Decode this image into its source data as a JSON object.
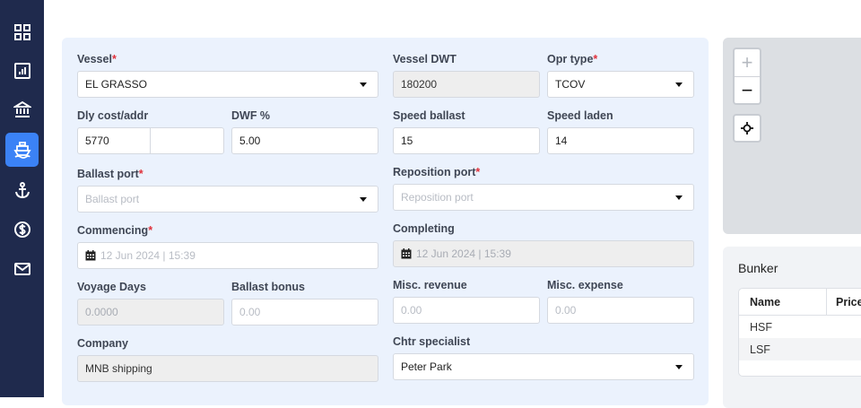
{
  "sidebar": {
    "items": [
      {
        "icon": "dashboard-grid-icon",
        "active": false
      },
      {
        "icon": "report-chart-icon",
        "active": false
      },
      {
        "icon": "bank-icon",
        "active": false
      },
      {
        "icon": "ship-icon",
        "active": true
      },
      {
        "icon": "anchor-icon",
        "active": false
      },
      {
        "icon": "dollar-icon",
        "active": false
      },
      {
        "icon": "mail-icon",
        "active": false
      }
    ],
    "accent": "#3b82f6",
    "background": "#1f2a4d"
  },
  "form": {
    "vessel": {
      "label": "Vessel",
      "required": "*",
      "value": "EL GRASSO"
    },
    "vessel_dwt": {
      "label": "Vessel DWT",
      "value": "180200"
    },
    "opr_type": {
      "label": "Opr type",
      "required": "*",
      "value": "TCOV"
    },
    "dly_cost": {
      "label": "Dly cost/addr",
      "value": "5770",
      "addr_value": ""
    },
    "dwf": {
      "label": "DWF %",
      "value": "5.00"
    },
    "speed_ballast": {
      "label": "Speed ballast",
      "value": "15"
    },
    "speed_laden": {
      "label": "Speed laden",
      "value": "14"
    },
    "ballast_port": {
      "label": "Ballast port",
      "required": "*",
      "placeholder": "Ballast port"
    },
    "reposition_port": {
      "label": "Reposition port",
      "required": "*",
      "placeholder": "Reposition port"
    },
    "commencing": {
      "label": "Commencing",
      "required": "*",
      "placeholder": "12 Jun 2024 | 15:39"
    },
    "completing": {
      "label": "Completing",
      "placeholder": "12 Jun 2024 | 15:39"
    },
    "voyage_days": {
      "label": "Voyage Days",
      "placeholder": "0.0000"
    },
    "ballast_bonus": {
      "label": "Ballast bonus",
      "placeholder": "0.00"
    },
    "misc_revenue": {
      "label": "Misc. revenue",
      "placeholder": "0.00"
    },
    "misc_expense": {
      "label": "Misc. expense",
      "placeholder": "0.00"
    },
    "company": {
      "label": "Company",
      "value": "MNB shipping"
    },
    "chtr_specialist": {
      "label": "Chtr specialist",
      "value": "Peter Park"
    }
  },
  "map": {
    "zoom_in": "+",
    "zoom_out": "−"
  },
  "bunker": {
    "title": "Bunker",
    "columns": [
      "Name",
      "Price"
    ],
    "rows": [
      {
        "name": "HSF"
      },
      {
        "name": "LSF"
      }
    ]
  }
}
